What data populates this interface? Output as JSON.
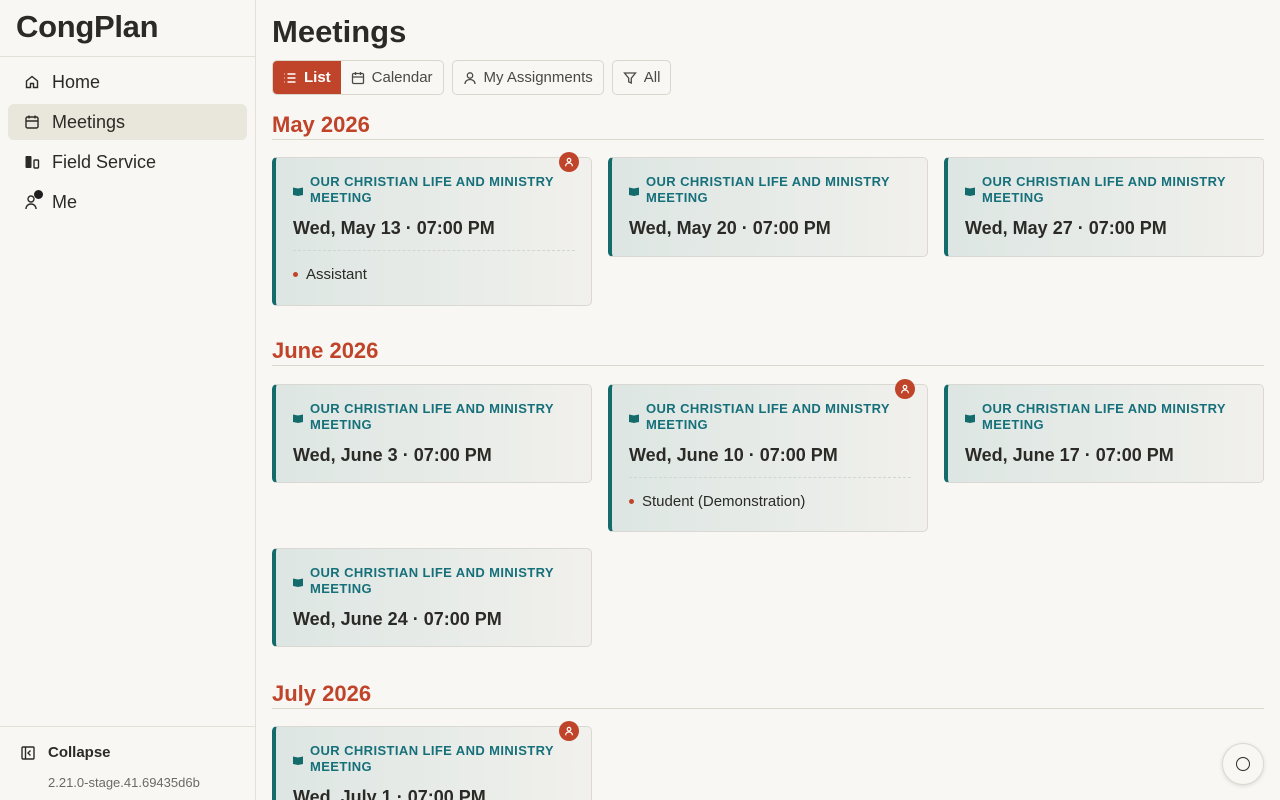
{
  "app": {
    "name": "CongPlan",
    "version": "2.21.0-stage.41.69435d6b"
  },
  "sidebar": {
    "items": [
      {
        "label": "Home",
        "icon": "home-icon",
        "active": false
      },
      {
        "label": "Meetings",
        "icon": "calendar-icon",
        "active": true
      },
      {
        "label": "Field Service",
        "icon": "field-service-icon",
        "active": false
      },
      {
        "label": "Me",
        "icon": "user-icon",
        "active": false
      }
    ],
    "collapse_label": "Collapse"
  },
  "page": {
    "title": "Meetings"
  },
  "toolbar": {
    "list_label": "List",
    "calendar_label": "Calendar",
    "my_assignments_label": "My Assignments",
    "filter_label": "All"
  },
  "months": [
    {
      "label": "May 2026",
      "meetings": [
        {
          "type": "OUR CHRISTIAN LIFE AND MINISTRY MEETING",
          "date": "Wed, May 13 · 07:00 PM",
          "assigned": true,
          "role": "Assistant"
        },
        {
          "type": "OUR CHRISTIAN LIFE AND MINISTRY MEETING",
          "date": "Wed, May 20 · 07:00 PM",
          "assigned": false
        },
        {
          "type": "OUR CHRISTIAN LIFE AND MINISTRY MEETING",
          "date": "Wed, May 27 · 07:00 PM",
          "assigned": false
        }
      ]
    },
    {
      "label": "June 2026",
      "meetings": [
        {
          "type": "OUR CHRISTIAN LIFE AND MINISTRY MEETING",
          "date": "Wed, June 3 · 07:00 PM",
          "assigned": false
        },
        {
          "type": "OUR CHRISTIAN LIFE AND MINISTRY MEETING",
          "date": "Wed, June 10 · 07:00 PM",
          "assigned": true,
          "role": "Student (Demonstration)"
        },
        {
          "type": "OUR CHRISTIAN LIFE AND MINISTRY MEETING",
          "date": "Wed, June 17 · 07:00 PM",
          "assigned": false
        },
        {
          "type": "OUR CHRISTIAN LIFE AND MINISTRY MEETING",
          "date": "Wed, June 24 · 07:00 PM",
          "assigned": false
        }
      ]
    },
    {
      "label": "July 2026",
      "meetings": [
        {
          "type": "OUR CHRISTIAN LIFE AND MINISTRY MEETING",
          "date": "Wed, July 1 · 07:00 PM",
          "assigned": true
        }
      ]
    }
  ],
  "colors": {
    "accent": "#c0442a",
    "teal": "#146b6b",
    "background": "#f9f7f3"
  }
}
